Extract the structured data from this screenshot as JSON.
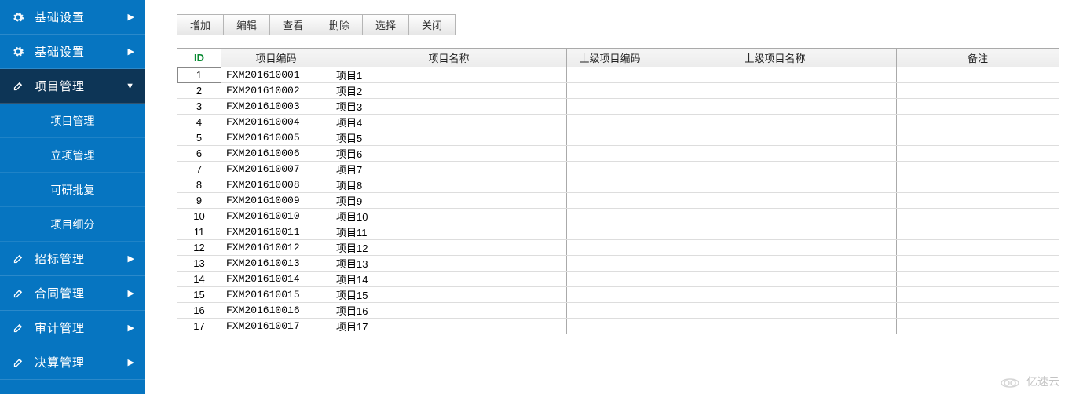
{
  "sidebar": {
    "items": [
      {
        "icon": "gear",
        "label": "基础设置",
        "caret": "right",
        "active": false,
        "sub": []
      },
      {
        "icon": "gear",
        "label": "基础设置",
        "caret": "right",
        "active": false,
        "sub": []
      },
      {
        "icon": "edit",
        "label": "项目管理",
        "caret": "down",
        "active": true,
        "sub": [
          "项目管理",
          "立项管理",
          "可研批复",
          "项目细分"
        ]
      },
      {
        "icon": "edit",
        "label": "招标管理",
        "caret": "right",
        "active": false,
        "sub": []
      },
      {
        "icon": "edit",
        "label": "合同管理",
        "caret": "right",
        "active": false,
        "sub": []
      },
      {
        "icon": "edit",
        "label": "审计管理",
        "caret": "right",
        "active": false,
        "sub": []
      },
      {
        "icon": "edit",
        "label": "决算管理",
        "caret": "right",
        "active": false,
        "sub": []
      }
    ]
  },
  "toolbar": {
    "buttons": [
      "增加",
      "编辑",
      "查看",
      "删除",
      "选择",
      "关闭"
    ]
  },
  "grid": {
    "columns": [
      "ID",
      "项目编码",
      "项目名称",
      "上级项目编码",
      "上级项目名称",
      "备注"
    ],
    "rows": [
      {
        "id": "1",
        "code": "FXM201610001",
        "name": "项目1",
        "pcode": "",
        "pname": "",
        "remark": ""
      },
      {
        "id": "2",
        "code": "FXM201610002",
        "name": "项目2",
        "pcode": "",
        "pname": "",
        "remark": ""
      },
      {
        "id": "3",
        "code": "FXM201610003",
        "name": "项目3",
        "pcode": "",
        "pname": "",
        "remark": ""
      },
      {
        "id": "4",
        "code": "FXM201610004",
        "name": "项目4",
        "pcode": "",
        "pname": "",
        "remark": ""
      },
      {
        "id": "5",
        "code": "FXM201610005",
        "name": "项目5",
        "pcode": "",
        "pname": "",
        "remark": ""
      },
      {
        "id": "6",
        "code": "FXM201610006",
        "name": "项目6",
        "pcode": "",
        "pname": "",
        "remark": ""
      },
      {
        "id": "7",
        "code": "FXM201610007",
        "name": "项目7",
        "pcode": "",
        "pname": "",
        "remark": ""
      },
      {
        "id": "8",
        "code": "FXM201610008",
        "name": "项目8",
        "pcode": "",
        "pname": "",
        "remark": ""
      },
      {
        "id": "9",
        "code": "FXM201610009",
        "name": "项目9",
        "pcode": "",
        "pname": "",
        "remark": ""
      },
      {
        "id": "10",
        "code": "FXM201610010",
        "name": "项目10",
        "pcode": "",
        "pname": "",
        "remark": ""
      },
      {
        "id": "11",
        "code": "FXM201610011",
        "name": "项目11",
        "pcode": "",
        "pname": "",
        "remark": ""
      },
      {
        "id": "12",
        "code": "FXM201610012",
        "name": "项目12",
        "pcode": "",
        "pname": "",
        "remark": ""
      },
      {
        "id": "13",
        "code": "FXM201610013",
        "name": "项目13",
        "pcode": "",
        "pname": "",
        "remark": ""
      },
      {
        "id": "14",
        "code": "FXM201610014",
        "name": "项目14",
        "pcode": "",
        "pname": "",
        "remark": ""
      },
      {
        "id": "15",
        "code": "FXM201610015",
        "name": "项目15",
        "pcode": "",
        "pname": "",
        "remark": ""
      },
      {
        "id": "16",
        "code": "FXM201610016",
        "name": "项目16",
        "pcode": "",
        "pname": "",
        "remark": ""
      },
      {
        "id": "17",
        "code": "FXM201610017",
        "name": "项目17",
        "pcode": "",
        "pname": "",
        "remark": ""
      }
    ]
  },
  "watermark": "亿速云"
}
